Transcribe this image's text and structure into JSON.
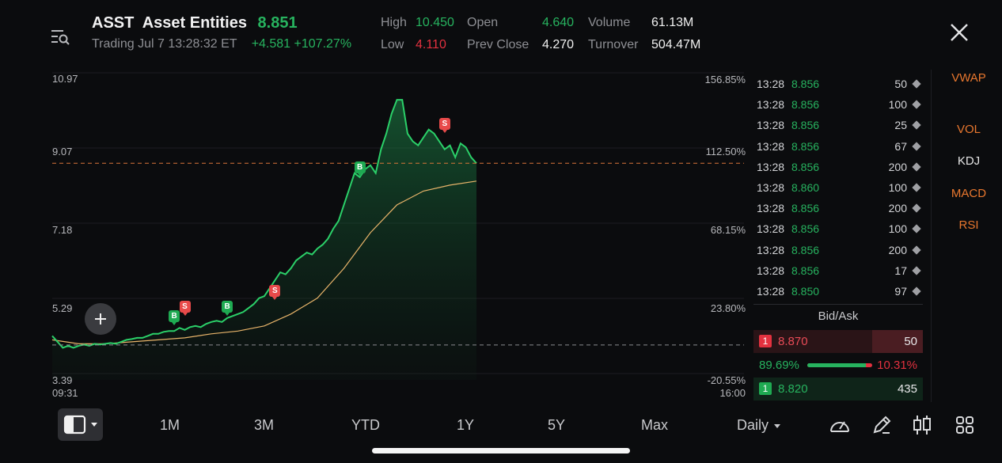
{
  "header": {
    "ticker": "ASST",
    "name": "Asset Entities",
    "price": "8.851",
    "status": "Trading Jul 7 13:28:32 ET",
    "change": "+4.581",
    "change_pct": "+107.27%",
    "high_label": "High",
    "high": "10.450",
    "low_label": "Low",
    "low": "4.110",
    "open_label": "Open",
    "open": "4.640",
    "prev_close_label": "Prev Close",
    "prev_close": "4.270",
    "volume_label": "Volume",
    "volume": "61.13M",
    "turnover_label": "Turnover",
    "turnover": "504.47M"
  },
  "icons": {
    "menu": "list-search-icon",
    "close": "close-icon",
    "add": "plus-icon",
    "layout": "split-view-icon"
  },
  "chart_data": {
    "type": "area",
    "xlabel": "",
    "ylabel": "",
    "x_ticks": [
      "09:31",
      "16:00"
    ],
    "y_ticks_left": [
      "10.97",
      "9.07",
      "7.18",
      "5.29",
      "3.39"
    ],
    "y_ticks_right": [
      "156.85%",
      "112.50%",
      "68.15%",
      "23.80%",
      "-20.55%"
    ],
    "ylim": [
      3.39,
      10.97
    ],
    "prev_close": 4.27,
    "last_price": 8.851,
    "series": [
      {
        "name": "",
        "type": "price",
        "x": [
          0,
          1,
          2,
          3,
          4,
          5,
          6,
          7,
          8,
          9,
          10,
          11,
          12,
          13,
          14,
          15,
          16,
          17,
          18,
          19,
          20,
          21,
          22,
          23,
          24,
          25,
          26,
          27,
          28,
          29,
          30,
          31,
          32,
          33,
          34,
          35,
          36,
          37,
          38,
          39,
          40,
          41,
          42,
          43,
          44,
          45,
          46,
          47,
          48,
          49,
          50,
          51,
          52,
          53,
          54,
          55,
          56,
          57,
          58,
          59,
          60,
          61,
          62,
          63,
          64,
          65,
          66,
          67,
          68,
          69,
          70,
          71,
          72,
          73,
          74,
          75,
          76,
          77,
          78,
          79,
          80
        ],
        "values": [
          4.5,
          4.35,
          4.2,
          4.25,
          4.2,
          4.25,
          4.28,
          4.25,
          4.3,
          4.28,
          4.3,
          4.32,
          4.3,
          4.35,
          4.4,
          4.42,
          4.45,
          4.45,
          4.5,
          4.55,
          4.55,
          4.6,
          4.62,
          4.62,
          4.7,
          4.65,
          4.72,
          4.75,
          4.72,
          4.8,
          4.85,
          4.88,
          4.85,
          4.95,
          5.0,
          5.05,
          5.1,
          5.2,
          5.3,
          5.45,
          5.5,
          5.7,
          5.9,
          6.1,
          6.05,
          6.2,
          6.4,
          6.5,
          6.6,
          6.55,
          6.7,
          6.8,
          6.95,
          7.2,
          7.4,
          7.8,
          8.2,
          8.6,
          8.5,
          8.7,
          8.8,
          8.6,
          9.2,
          9.6,
          10.1,
          10.45,
          10.45,
          9.6,
          9.4,
          9.3,
          9.5,
          9.7,
          9.6,
          9.4,
          9.2,
          9.3,
          9.0,
          9.35,
          9.25,
          9.0,
          8.85
        ]
      },
      {
        "name": "VWAP",
        "type": "vwap",
        "x": [
          0,
          5,
          10,
          15,
          20,
          25,
          30,
          35,
          40,
          45,
          50,
          55,
          60,
          65,
          70,
          75,
          80
        ],
        "values": [
          4.4,
          4.3,
          4.3,
          4.35,
          4.4,
          4.45,
          4.55,
          4.62,
          4.75,
          5.05,
          5.45,
          6.2,
          7.1,
          7.8,
          8.15,
          8.3,
          8.4
        ]
      }
    ],
    "trade_markers": [
      {
        "type": "B",
        "x": 23,
        "price": 4.7
      },
      {
        "type": "S",
        "x": 25,
        "price": 4.95
      },
      {
        "type": "B",
        "x": 33,
        "price": 4.95
      },
      {
        "type": "S",
        "x": 42,
        "price": 5.35
      },
      {
        "type": "B",
        "x": 58,
        "price": 8.45
      },
      {
        "type": "S",
        "x": 74,
        "price": 9.55
      }
    ]
  },
  "time_sales": [
    {
      "time": "13:28",
      "price": "8.856",
      "volume": "50"
    },
    {
      "time": "13:28",
      "price": "8.856",
      "volume": "100"
    },
    {
      "time": "13:28",
      "price": "8.856",
      "volume": "25"
    },
    {
      "time": "13:28",
      "price": "8.856",
      "volume": "67"
    },
    {
      "time": "13:28",
      "price": "8.856",
      "volume": "200"
    },
    {
      "time": "13:28",
      "price": "8.860",
      "volume": "100"
    },
    {
      "time": "13:28",
      "price": "8.856",
      "volume": "200"
    },
    {
      "time": "13:28",
      "price": "8.856",
      "volume": "100"
    },
    {
      "time": "13:28",
      "price": "8.856",
      "volume": "200"
    },
    {
      "time": "13:28",
      "price": "8.856",
      "volume": "17"
    },
    {
      "time": "13:28",
      "price": "8.850",
      "volume": "97"
    }
  ],
  "bid_ask": {
    "title": "Bid/Ask",
    "ask": {
      "level": "1",
      "price": "8.870",
      "size": "50"
    },
    "bid_pct": "89.69%",
    "ask_pct": "10.31%",
    "bid_ratio": 0.8969,
    "bid": {
      "level": "1",
      "price": "8.820",
      "size": "435"
    }
  },
  "indicators": [
    "VWAP",
    "VOL",
    "KDJ",
    "MACD",
    "RSI"
  ],
  "indicator_colors": {
    "active": "#e8772e",
    "inactive": "#e6e6e6"
  },
  "range_tabs": [
    "1M",
    "3M",
    "YTD",
    "1Y",
    "5Y",
    "Max"
  ],
  "interval": "Daily",
  "toolbar_icons": [
    "speedometer-icon",
    "pencil-icon",
    "candlestick-icon",
    "grid-icon"
  ]
}
